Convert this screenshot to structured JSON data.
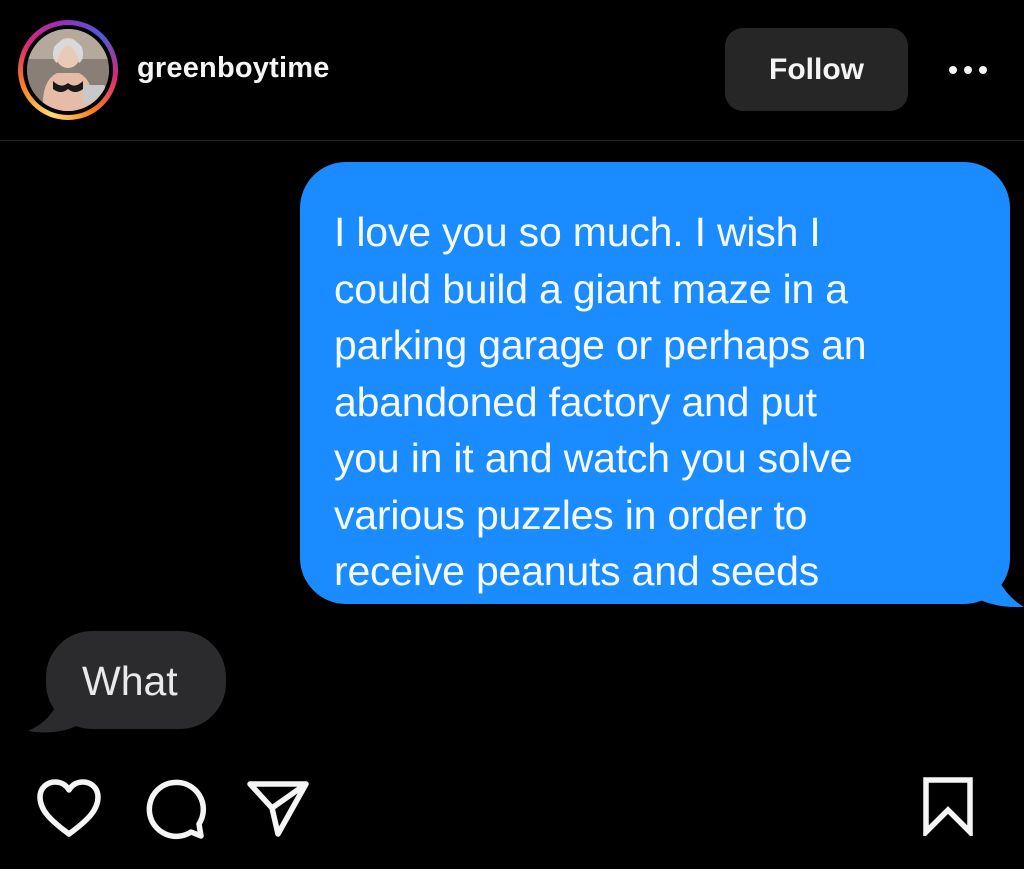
{
  "header": {
    "username": "greenboytime",
    "follow_label": "Follow",
    "avatar_icon": "profile-avatar",
    "more_icon": "more-options-icon"
  },
  "conversation": {
    "sent_message": "I love you so much. I wish I\ncould build a giant maze in a\nparking garage or perhaps an\nabandoned factory and put\nyou in it and watch you solve\nvarious puzzles in order to\nreceive peanuts and seeds",
    "received_message": "What"
  },
  "actions": {
    "like_icon": "heart-icon",
    "comment_icon": "comment-icon",
    "share_icon": "send-icon",
    "save_icon": "bookmark-icon"
  },
  "colors": {
    "background": "#000000",
    "sent_bubble": "#1a8cff",
    "received_bubble": "#2b2b2e",
    "follow_button": "#262626",
    "text": "#f5f5f5"
  }
}
